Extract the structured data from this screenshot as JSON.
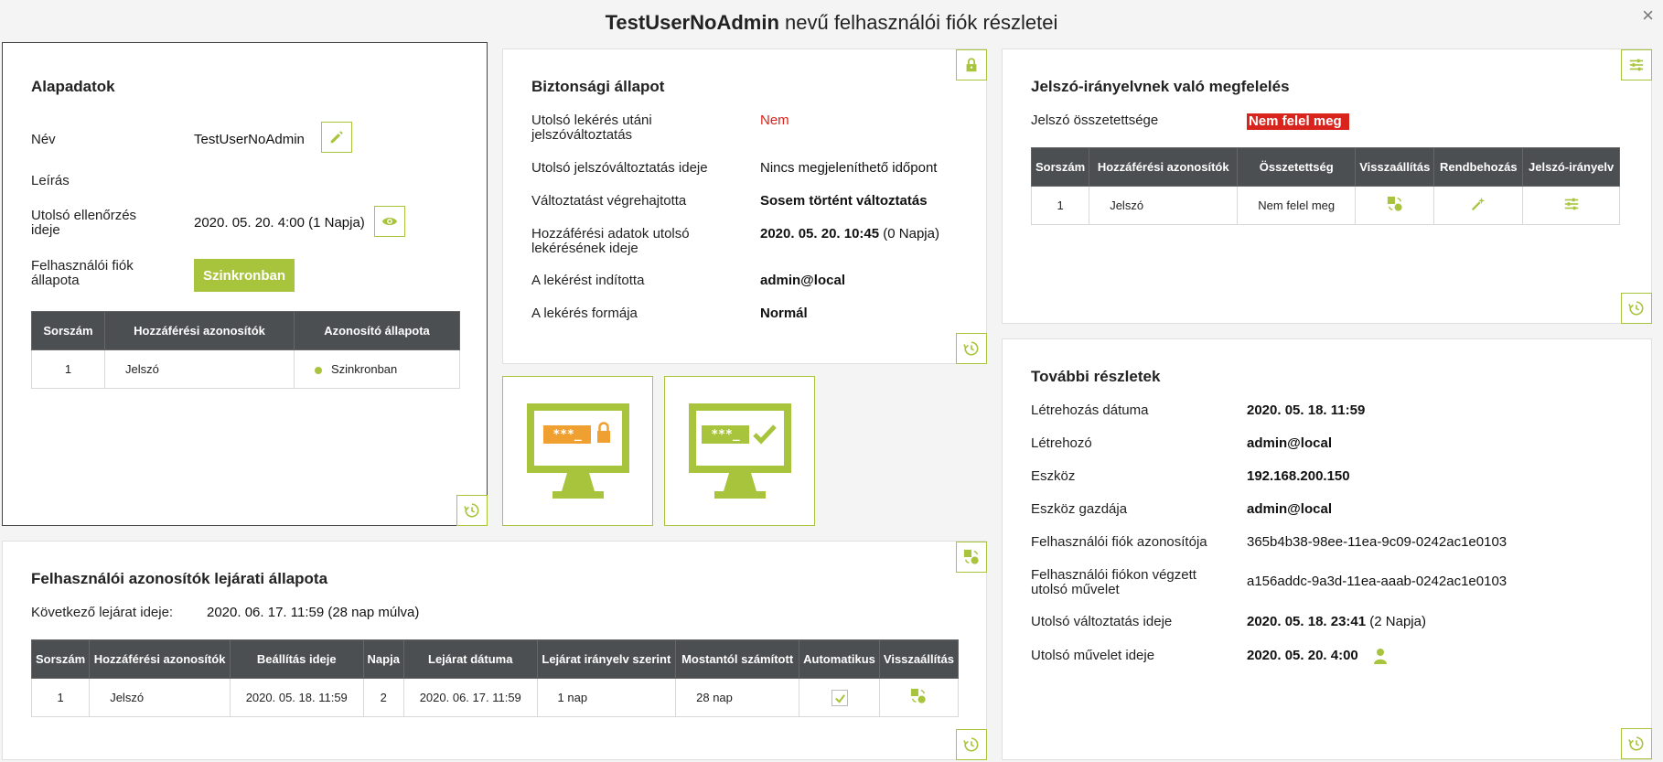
{
  "header": {
    "title_bold": "TestUserNoAdmin",
    "title_rest": " nevű felhasználói fiók részletei",
    "close": "×"
  },
  "basic": {
    "title": "Alapadatok",
    "name_label": "Név",
    "name_value": "TestUserNoAdmin",
    "desc_label": "Leírás",
    "lastcheck_label": "Utolsó ellenőrzés ideje",
    "lastcheck_value": "2020. 05. 20. 4:00",
    "lastcheck_days": " (1 Napja)",
    "status_label": "Felhasználói fiók állapota",
    "status_button": "Szinkronban",
    "table": {
      "headers": [
        "Sorszám",
        "Hozzáférési azonosítók",
        "Azonosító állapota"
      ],
      "rows": [
        [
          "1",
          "Jelszó",
          "Szinkronban"
        ]
      ]
    }
  },
  "security": {
    "title": "Biztonsági állapot",
    "rows": [
      {
        "label": "Utolsó lekérés utáni jelszóváltoztatás",
        "value": "Nem"
      },
      {
        "label": "Utolsó jelszóváltoztatás ideje",
        "value": "Nincs megjeleníthető időpont"
      },
      {
        "label": "Változtatást végrehajtotta",
        "value": "Sosem történt változtatás"
      },
      {
        "label": "Hozzáférési adatok utolsó lekérésének ideje",
        "value": "2020. 05. 20. 10:45",
        "value_extra": " (0 Napja)"
      },
      {
        "label": "A lekérést indította",
        "value": "admin@local"
      },
      {
        "label": "A lekérés formája",
        "value": "Normál"
      }
    ],
    "tile1_text": "***_",
    "tile2_text": "***_"
  },
  "policy": {
    "title": "Jelszó-irányelvnek való megfelelés",
    "complexity_label": "Jelszó összetettsége",
    "complexity_value": "Nem felel meg",
    "table": {
      "headers": [
        "Sorszám",
        "Hozzáférési azonosítók",
        "Összetettség",
        "Visszaállítás",
        "Rendbehozás",
        "Jelszó-irányelv"
      ],
      "rows": [
        [
          "1",
          "Jelszó",
          "Nem felel meg"
        ]
      ]
    }
  },
  "more": {
    "title": "További részletek",
    "rows": [
      {
        "label": "Létrehozás dátuma",
        "value": "2020. 05. 18. 11:59"
      },
      {
        "label": "Létrehozó",
        "value": "admin@local"
      },
      {
        "label": "Eszköz",
        "value": "192.168.200.150"
      },
      {
        "label": "Eszköz gazdája",
        "value": "admin@local"
      },
      {
        "label": "Felhasználói fiók azonosítója",
        "value": "365b4b38-98ee-11ea-9c09-0242ac1e0103"
      },
      {
        "label": "Felhasználói fiókon végzett utolsó művelet",
        "value": "a156addc-9a3d-11ea-aaab-0242ac1e0103"
      },
      {
        "label": "Utolsó változtatás ideje",
        "value": "2020. 05. 18. 23:41",
        "value_extra": " (2 Napja)"
      },
      {
        "label": "Utolsó művelet ideje",
        "value": "2020. 05. 20. 4:00"
      }
    ]
  },
  "expiry": {
    "title": "Felhasználói azonosítók lejárati állapota",
    "next_label": "Következő lejárat ideje:",
    "next_value": "2020. 06. 17. 11:59 (28 nap múlva)",
    "table": {
      "headers": [
        "Sorszám",
        "Hozzáférési azonosítók",
        "Beállítás ideje",
        "Napja",
        "Lejárat dátuma",
        "Lejárat irányelv szerint",
        "Mostantól számított",
        "Automatikus",
        "Visszaállítás"
      ],
      "rows": [
        [
          "1",
          "Jelszó",
          "2020. 05. 18. 11:59",
          "2",
          "2020. 06. 17. 11:59",
          "1 nap",
          "28 nap"
        ]
      ]
    }
  },
  "colors": {
    "accent": "#a8c43c",
    "warn": "#d9231d",
    "orange": "#f0a030",
    "header_bg": "#4b4f52"
  }
}
